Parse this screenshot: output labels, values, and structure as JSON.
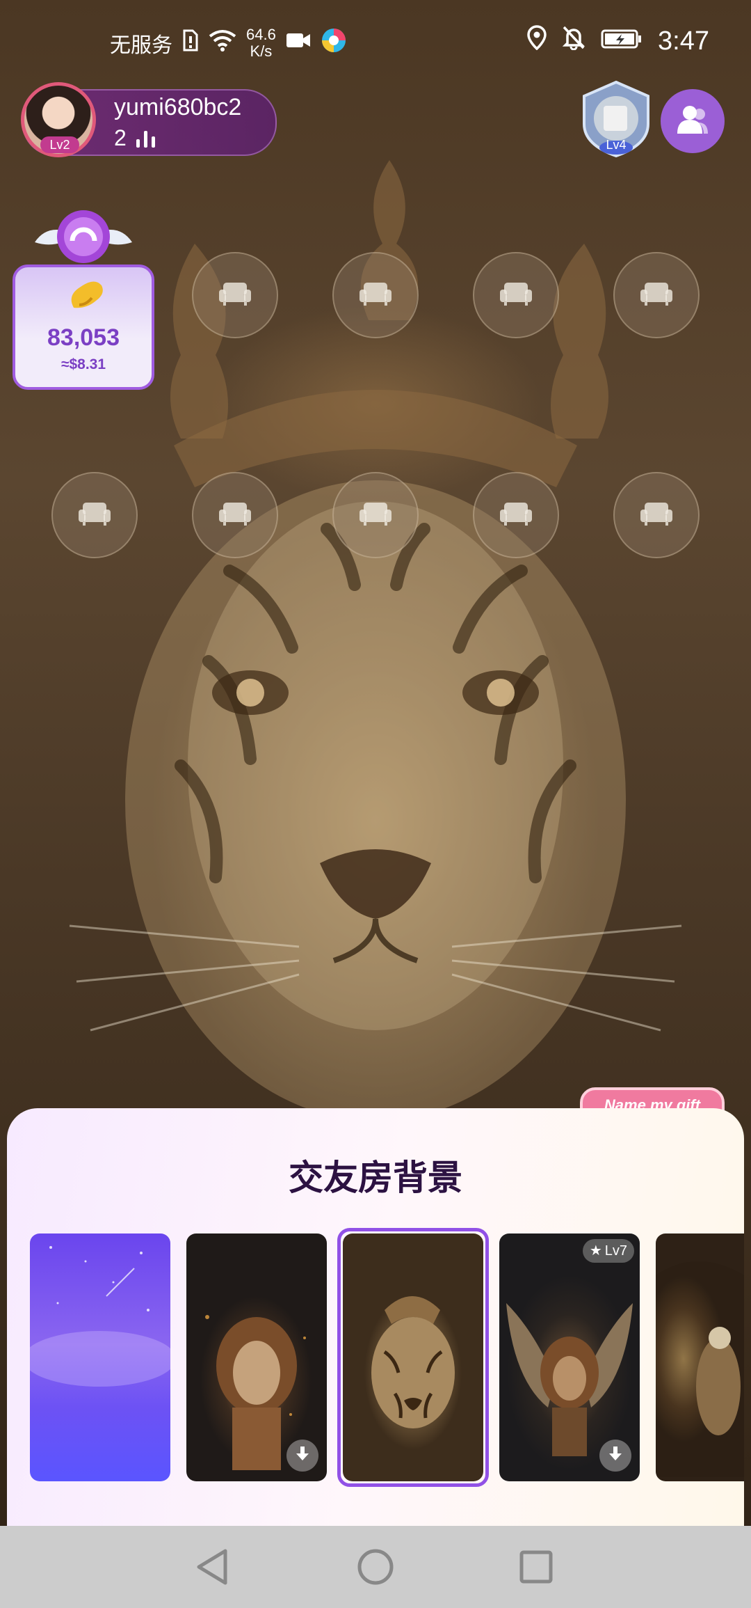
{
  "status_bar": {
    "carrier": "无服务",
    "speed_value": "64.6",
    "speed_unit": "K/s",
    "time": "3:47"
  },
  "header": {
    "username": "yumi680bc2",
    "user_level": "Lv2",
    "viewer_count": "2",
    "trophy_level": "Lv4"
  },
  "beans": {
    "amount": "83,053",
    "usd": "≈$8.31"
  },
  "gift_button": {
    "label": "Name my gift"
  },
  "sheet": {
    "title": "交友房背景",
    "backgrounds": [
      {
        "name": "purple-starry",
        "selected": false,
        "downloadable": false
      },
      {
        "name": "lion",
        "selected": false,
        "downloadable": true
      },
      {
        "name": "tiger-crown",
        "selected": true,
        "downloadable": false
      },
      {
        "name": "winged-lion",
        "selected": false,
        "downloadable": true,
        "level_tag": "Lv7"
      },
      {
        "name": "eagle-hall",
        "selected": false,
        "downloadable": false
      }
    ]
  },
  "colors": {
    "accent": "#9151e6",
    "bean_text": "#7b3fc4",
    "sheet_title": "#2c1242"
  }
}
